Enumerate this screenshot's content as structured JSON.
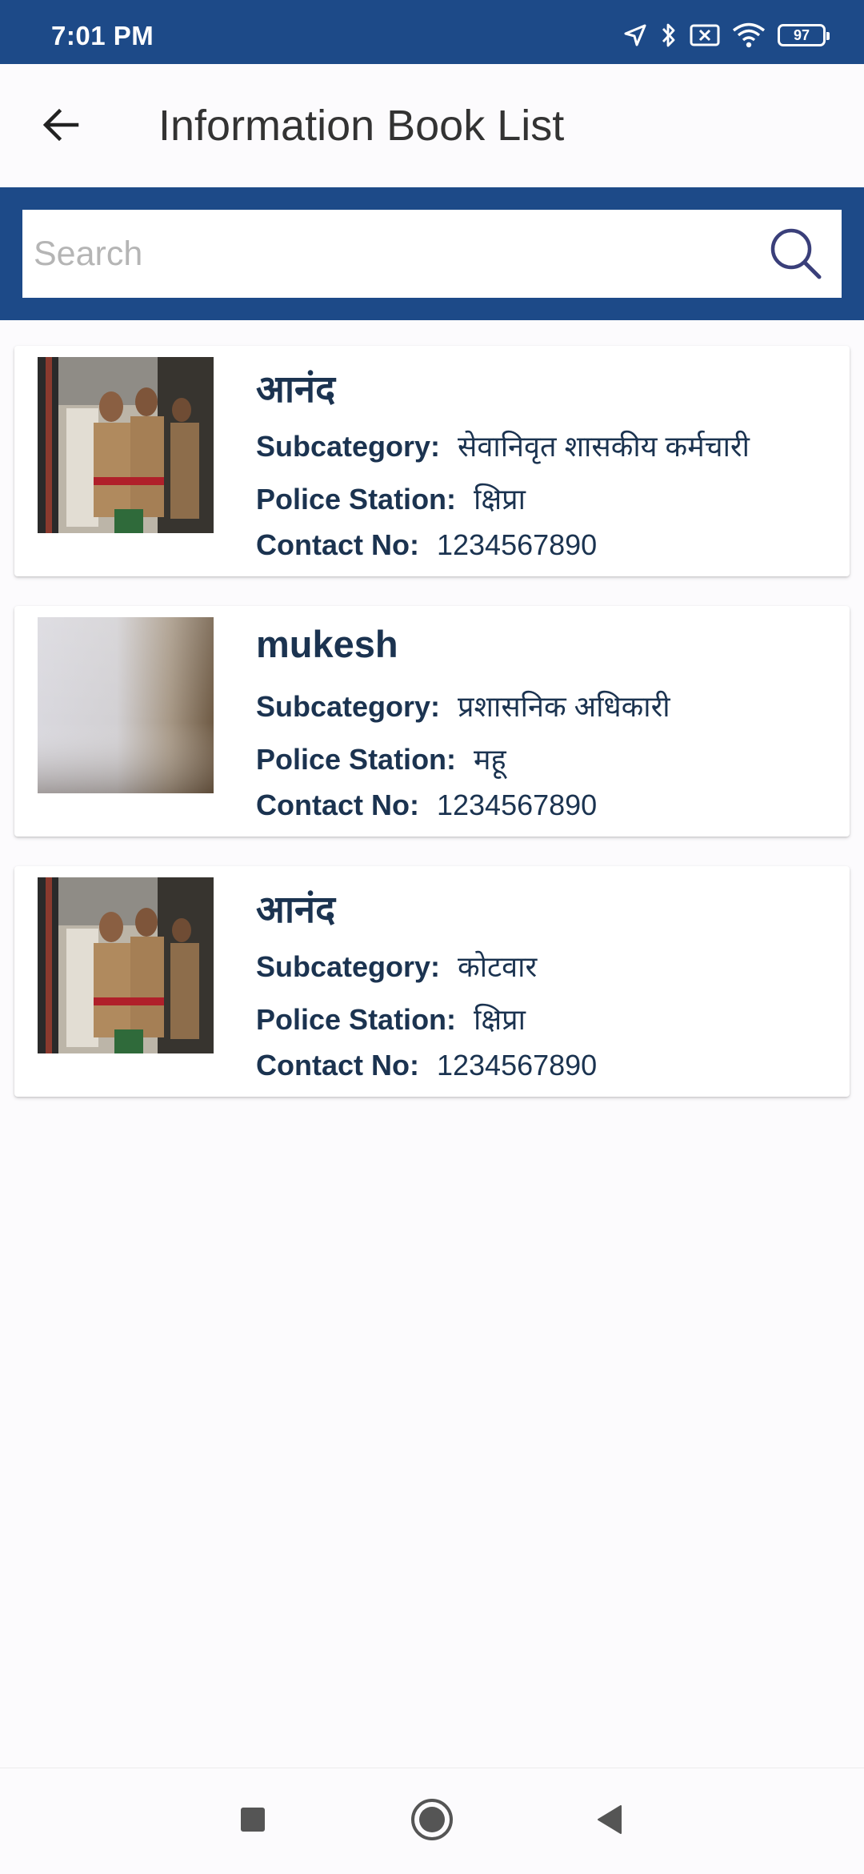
{
  "status_bar": {
    "time": "7:01 PM",
    "battery": "97",
    "icons": [
      "location-arrow-icon",
      "bluetooth-icon",
      "sim-off-icon",
      "wifi-icon",
      "battery-icon"
    ]
  },
  "header": {
    "title": "Information Book List",
    "back_icon": "back-arrow-icon"
  },
  "search": {
    "placeholder": "Search",
    "value": "",
    "icon": "search-icon"
  },
  "list": {
    "items": [
      {
        "name": "आनंद",
        "subcategory_label": "Subcategory:",
        "subcategory": "सेवानिवृत शासकीय कर्मचारी",
        "police_station_label": "Police Station:",
        "police_station": "क्षिप्रा",
        "contact_label": "Contact No:",
        "contact": "1234567890"
      },
      {
        "name": "mukesh",
        "subcategory_label": "Subcategory:",
        "subcategory": "प्रशासनिक अधिकारी",
        "police_station_label": "Police Station:",
        "police_station": "महू",
        "contact_label": "Contact No:",
        "contact": "1234567890"
      },
      {
        "name": "आनंद",
        "subcategory_label": "Subcategory:",
        "subcategory": "कोटवार",
        "police_station_label": "Police Station:",
        "police_station": "क्षिप्रा",
        "contact_label": "Contact No:",
        "contact": "1234567890"
      }
    ]
  },
  "nav_bar": {
    "icons": [
      "recents-square-icon",
      "home-circle-icon",
      "back-triangle-icon"
    ]
  },
  "colors": {
    "primary": "#1d4a88",
    "text": "#1b3350",
    "title": "#333333",
    "search_icon": "#3a3f7a",
    "background": "#fcfbfd"
  }
}
